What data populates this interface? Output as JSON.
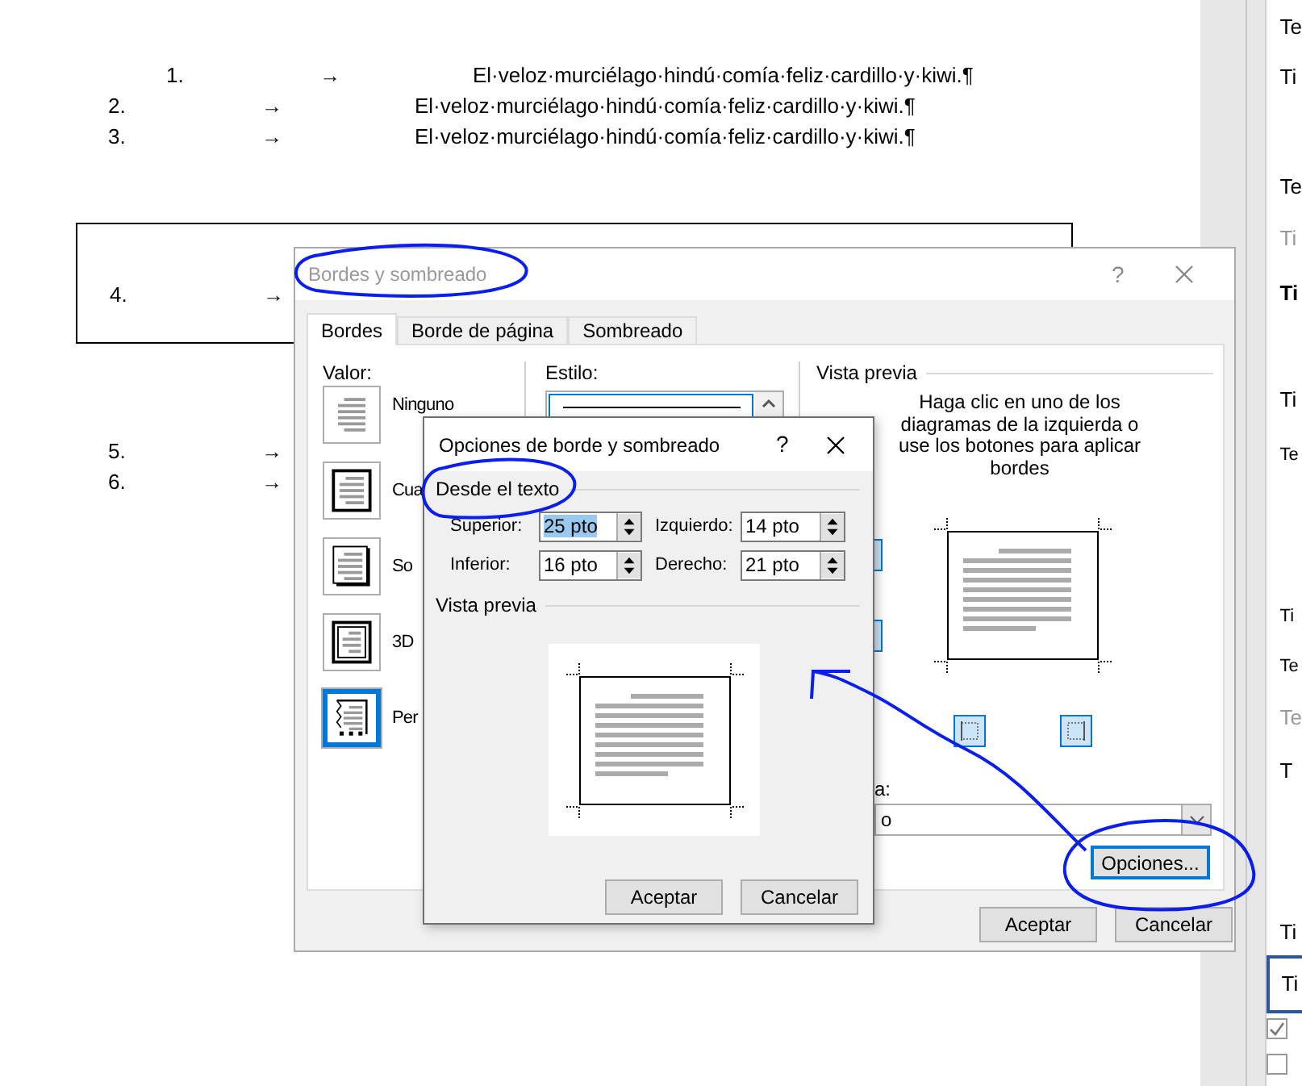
{
  "document": {
    "list_top": [
      {
        "number": "1.",
        "arrow": "→",
        "text": "El·veloz·murciélago·hindú·comía·feliz·cardillo·y·kiwi.¶",
        "kind": "indented"
      },
      {
        "number": "2.",
        "arrow": "→",
        "text": "El·veloz·murciélago·hindú·comía·feliz·cardillo·y·kiwi.¶",
        "kind": "normal"
      },
      {
        "number": "3.",
        "arrow": "→",
        "text": "El·veloz·murciélago·hindú·comía·feliz·cardillo·y·kiwi.¶",
        "kind": "normal"
      }
    ],
    "bordered_paragraph": {
      "number": "4.",
      "arrow": "→"
    },
    "list_bottom": [
      {
        "number": "5.",
        "arrow": "→"
      },
      {
        "number": "6.",
        "arrow": "→"
      }
    ]
  },
  "side_panel": {
    "items": [
      {
        "text": "Te",
        "kind": "normal"
      },
      {
        "text": "Ti",
        "kind": "normal"
      },
      {
        "text": "Te",
        "kind": "normal"
      },
      {
        "text": "Ti",
        "kind": "muted"
      },
      {
        "text": "Ti",
        "kind": "bold"
      },
      {
        "text": "Ti",
        "kind": "normal"
      },
      {
        "text": "Te",
        "kind": "small"
      },
      {
        "text": "Ti",
        "kind": "small"
      },
      {
        "text": "Te",
        "kind": "small"
      },
      {
        "text": "Te",
        "kind": "muted"
      },
      {
        "text": "T",
        "kind": "normal"
      },
      {
        "text": "Ti",
        "kind": "normal"
      },
      {
        "text": "Ti",
        "kind": "boxed"
      }
    ],
    "checkboxes": [
      {
        "checked": true
      },
      {
        "checked": false
      }
    ]
  },
  "borders_dialog": {
    "title": "Bordes y sombreado",
    "active": false,
    "help": "?",
    "tabs": [
      {
        "label": "Bordes",
        "selected": true
      },
      {
        "label": "Borde de página",
        "selected": false
      },
      {
        "label": "Sombreado",
        "selected": false
      }
    ],
    "value": {
      "label": "Valor:",
      "options": [
        {
          "label": "Ninguno",
          "kind": "none",
          "selected": false
        },
        {
          "label": "Cua",
          "kind": "box",
          "selected": false
        },
        {
          "label": "So",
          "kind": "shadow",
          "selected": false
        },
        {
          "label": "3D",
          "kind": "double",
          "selected": false
        },
        {
          "label": "Per",
          "kind": "custom",
          "selected": true
        }
      ]
    },
    "style": {
      "label": "Estilo:"
    },
    "preview": {
      "label": "Vista previa",
      "instructions": "Haga clic en uno de los diagramas de la izquierda o use los botones para aplicar bordes"
    },
    "apply_to": {
      "label": "a:",
      "value": "o"
    },
    "options_button": {
      "label": "Opciones...",
      "focused": true
    },
    "buttons": [
      "Aceptar",
      "Cancelar"
    ]
  },
  "options_dialog": {
    "title": "Opciones de borde y sombreado",
    "active": true,
    "help": "?",
    "section": "Desde el texto",
    "fields": [
      {
        "label": "Superior:",
        "value": "25 pto",
        "selected": true
      },
      {
        "label": "Izquierdo:",
        "value": "14 pto",
        "selected": false
      },
      {
        "label": "Inferior:",
        "value": "16 pto",
        "selected": false
      },
      {
        "label": "Derecho:",
        "value": "21 pto",
        "selected": false
      }
    ],
    "preview_label": "Vista previa",
    "buttons": [
      "Aceptar",
      "Cancelar"
    ]
  }
}
